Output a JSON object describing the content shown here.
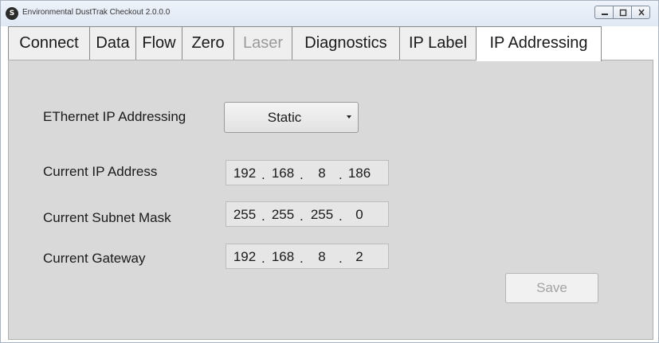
{
  "window": {
    "title": "Environmental DustTrak Checkout   2.0.0.0",
    "app_icon_glyph": "TSI",
    "controls": [
      "minimize",
      "maximize",
      "close"
    ]
  },
  "tabs": [
    {
      "label": "Connect",
      "state": "normal"
    },
    {
      "label": "Data",
      "state": "normal"
    },
    {
      "label": "Flow",
      "state": "normal"
    },
    {
      "label": "Zero",
      "state": "normal"
    },
    {
      "label": "Laser",
      "state": "disabled"
    },
    {
      "label": "Diagnostics",
      "state": "normal"
    },
    {
      "label": "IP Label",
      "state": "normal"
    },
    {
      "label": "IP Addressing",
      "state": "active"
    }
  ],
  "form": {
    "addressing_label": "EThernet IP Addressing",
    "addressing_value": "Static",
    "ip_label": "Current IP Address",
    "ip": [
      "192",
      "168",
      "8",
      "186"
    ],
    "subnet_label": "Current Subnet Mask",
    "subnet": [
      "255",
      "255",
      "255",
      "0"
    ],
    "gateway_label": "Current Gateway",
    "gateway": [
      "192",
      "168",
      "8",
      "2"
    ],
    "separator": ".",
    "save_label": "Save"
  },
  "colors": {
    "panel_bg": "#d9d9d9",
    "disabled_text": "#9a9a9a"
  }
}
